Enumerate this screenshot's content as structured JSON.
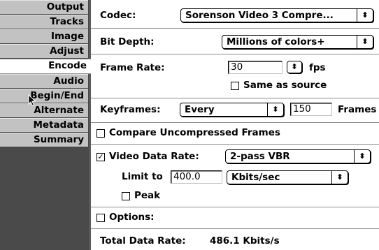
{
  "sidebar": {
    "tabs": [
      {
        "label": "Output"
      },
      {
        "label": "Tracks"
      },
      {
        "label": "Image"
      },
      {
        "label": "Adjust"
      },
      {
        "label": "Encode"
      },
      {
        "label": "Audio"
      },
      {
        "label": "Begin/End"
      },
      {
        "label": "Alternate"
      },
      {
        "label": "Metadata"
      },
      {
        "label": "Summary"
      }
    ],
    "active": "Encode"
  },
  "codec": {
    "label": "Codec:",
    "value": "Sorenson Video 3 Compre..."
  },
  "bit_depth": {
    "label": "Bit Depth:",
    "value": "Millions of colors+"
  },
  "frame_rate": {
    "label": "Frame Rate:",
    "value": "30",
    "unit": "fps",
    "same_as_source_label": "Same as source",
    "same_as_source_checked": false
  },
  "keyframes": {
    "label": "Keyframes:",
    "mode": "Every",
    "value": "150",
    "unit": "Frames"
  },
  "compare": {
    "label": "Compare Uncompressed Frames",
    "checked": false
  },
  "video_data_rate": {
    "label": "Video Data Rate:",
    "checked": true,
    "mode": "2-pass VBR",
    "limit_label": "Limit to",
    "limit_value": "400.0",
    "limit_unit": "Kbits/sec",
    "peak_label": "Peak",
    "peak_checked": false
  },
  "options": {
    "label": "Options:",
    "checked": false
  },
  "total": {
    "label": "Total Data Rate:",
    "value": "486.1 Kbits/s"
  },
  "icons": {
    "popup_arrow": "⬍",
    "check": "✓"
  }
}
